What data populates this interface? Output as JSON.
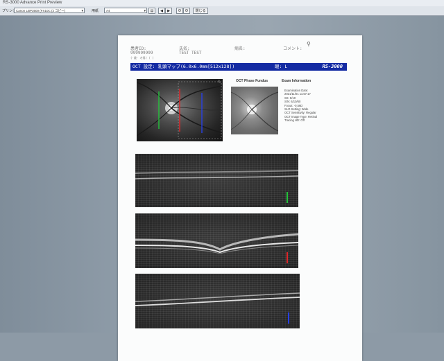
{
  "window": {
    "title": "RS-3000 Advance Print Preview"
  },
  "toolbar": {
    "printer_label": "プリンタ",
    "printer_value": "Canon LBP3500 (FX10C (2 コピー)",
    "paper_label": "用紙",
    "paper_value": "A4",
    "buttons": [
      "◀",
      "▶",
      "Θ",
      "Θ"
    ],
    "close_label": "閉じる"
  },
  "report": {
    "patient_id_label": "患者ID:",
    "patient_id": "999999999",
    "patient_sub": "(-歳- 才男) ( )",
    "name_label": "氏名:",
    "name": "TEST TEST",
    "disease_label": "病名:",
    "comment_label": "コメント:",
    "oct_bar": "OCT 設定: 乳頭マップ(6.0x6.0mm[512x128])",
    "eye_label": "眼: L",
    "logo": "RS-3000",
    "phase_title": "OCT Phase Fundus",
    "exam_title": "Exam Information",
    "fundus_eye_marker": "L",
    "exam_info": [
      "Examination Date:",
      "2021/11/01 11:57:17",
      "SS: 5/10",
      "S/N: 6/10/60",
      "Focus: -0.56D",
      "SLO Setting: Wide",
      "OCT Sensitivity: Regular",
      "OCT Image Type: Retinal",
      "Tracing HD: Off"
    ]
  },
  "colors": {
    "bar": "#142ba3",
    "marker_green": "#22c23a",
    "marker_red": "#e0262a",
    "marker_blue": "#2840e6"
  }
}
